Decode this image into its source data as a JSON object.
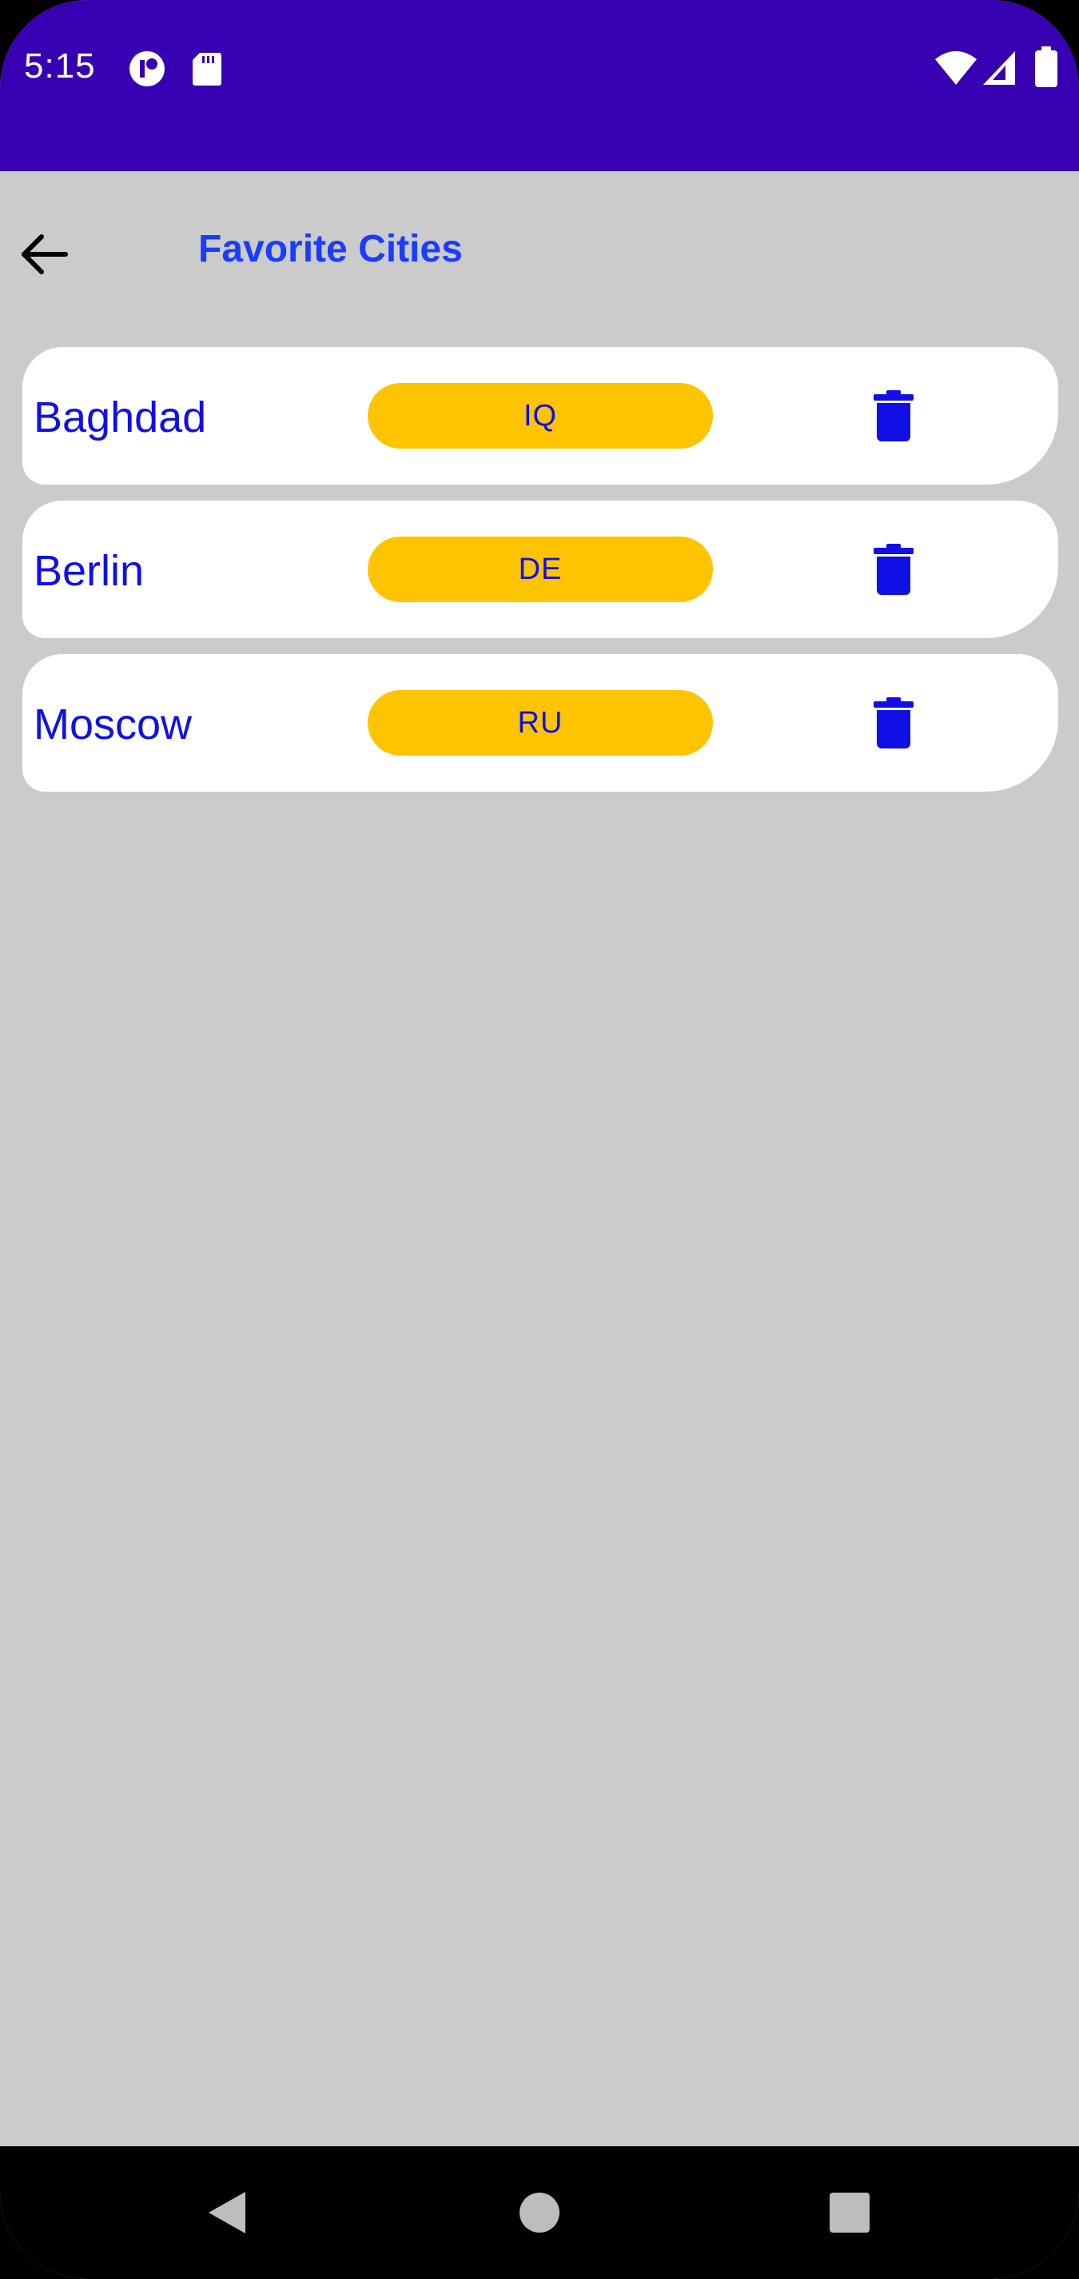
{
  "status_bar": {
    "time": "5:15",
    "left_icons": [
      "circle-status-icon",
      "sd-card-icon"
    ],
    "right_icons": [
      "wifi-icon",
      "signal-icon",
      "battery-icon"
    ],
    "background_color": "#3700b3"
  },
  "toolbar": {
    "title": "Favorite Cities",
    "back_icon": "arrow-back-icon",
    "title_color": "#1a3cff"
  },
  "cities": [
    {
      "name": "Baghdad",
      "country": "IQ",
      "action_icon": "trash-icon"
    },
    {
      "name": "Berlin",
      "country": "DE",
      "action_icon": "trash-icon"
    },
    {
      "name": "Moscow",
      "country": "RU",
      "action_icon": "trash-icon"
    }
  ],
  "colors": {
    "background": "#cbcbcb",
    "card": "#ffffff",
    "pill": "#ffc400",
    "accent": "#1010e6"
  },
  "nav_bar": {
    "buttons": [
      "back-triangle-icon",
      "home-circle-icon",
      "recents-square-icon"
    ]
  }
}
